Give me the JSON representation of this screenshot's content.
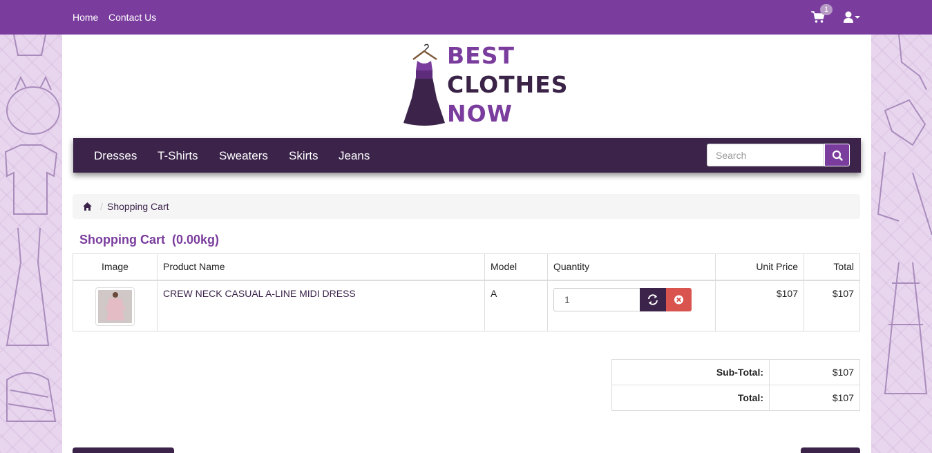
{
  "topbar": {
    "links": [
      "Home",
      "Contact Us"
    ],
    "cart_count": "1",
    "colors": {
      "topbar": "#7a3d9e",
      "nav": "#3b234a",
      "remove": "#d9534f"
    },
    "icons": [
      "shopping-cart-icon",
      "user-icon",
      "caret-down-icon"
    ]
  },
  "logo": {
    "lines": [
      "BEST",
      "CLOTHES",
      "NOW"
    ],
    "icon": "dress-hanger-icon"
  },
  "category_nav": {
    "items": [
      "Dresses",
      "T-Shirts",
      "Sweaters",
      "Skirts",
      "Jeans"
    ],
    "search": {
      "placeholder": "Search",
      "value": "",
      "icon": "search-icon"
    }
  },
  "breadcrumb": {
    "home_icon": "home-icon",
    "items": [
      "Shopping Cart"
    ]
  },
  "cart": {
    "title": "Shopping Cart  (0.00kg)",
    "columns": [
      "Image",
      "Product Name",
      "Model",
      "Quantity",
      "Unit Price",
      "Total"
    ],
    "rows": [
      {
        "product_name": "CREW NECK CASUAL A-LINE MIDI DRESS",
        "model": "A",
        "quantity": "1",
        "unit_price": "$107",
        "total": "$107",
        "update_icon": "refresh-icon",
        "remove_icon": "remove-circle-icon"
      }
    ]
  },
  "totals": [
    {
      "label": "Sub-Total:",
      "value": "$107"
    },
    {
      "label": "Total:",
      "value": "$107"
    }
  ]
}
